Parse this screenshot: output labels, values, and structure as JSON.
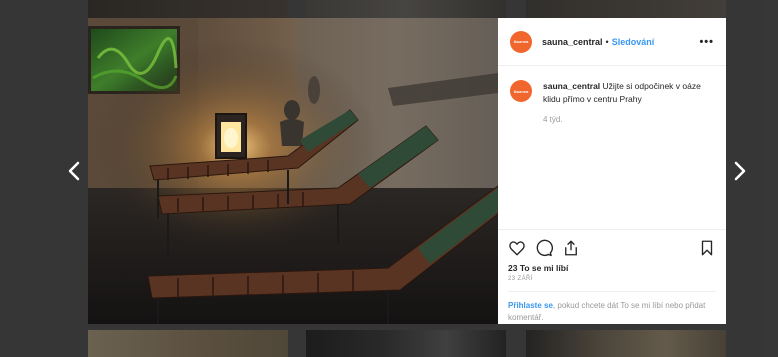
{
  "post": {
    "username": "sauna_central",
    "follow_label": "Sledování",
    "separator": "•",
    "more_label": "•••",
    "avatar_text": "Saunea",
    "caption_user": "sauna_central",
    "caption_text": "Užijte si odpočinek v oáze klidu přímo v centru Prahy",
    "caption_time": "4 týd.",
    "likes": "23 To se mi líbí",
    "date": "23 ZÁŘÍ",
    "login_link": "Přihlaste se",
    "login_text": ", pokud chcete dát To se mi líbí nebo přidat komentář."
  },
  "navigation": {
    "prev_icon": "chevron-left-icon",
    "next_icon": "chevron-right-icon"
  },
  "icons": [
    "heart-icon",
    "comment-icon",
    "share-icon",
    "bookmark-icon"
  ],
  "colors": {
    "accent": "#3897f0",
    "avatar": "#f0662c",
    "text": "#262626",
    "muted": "#999999"
  }
}
